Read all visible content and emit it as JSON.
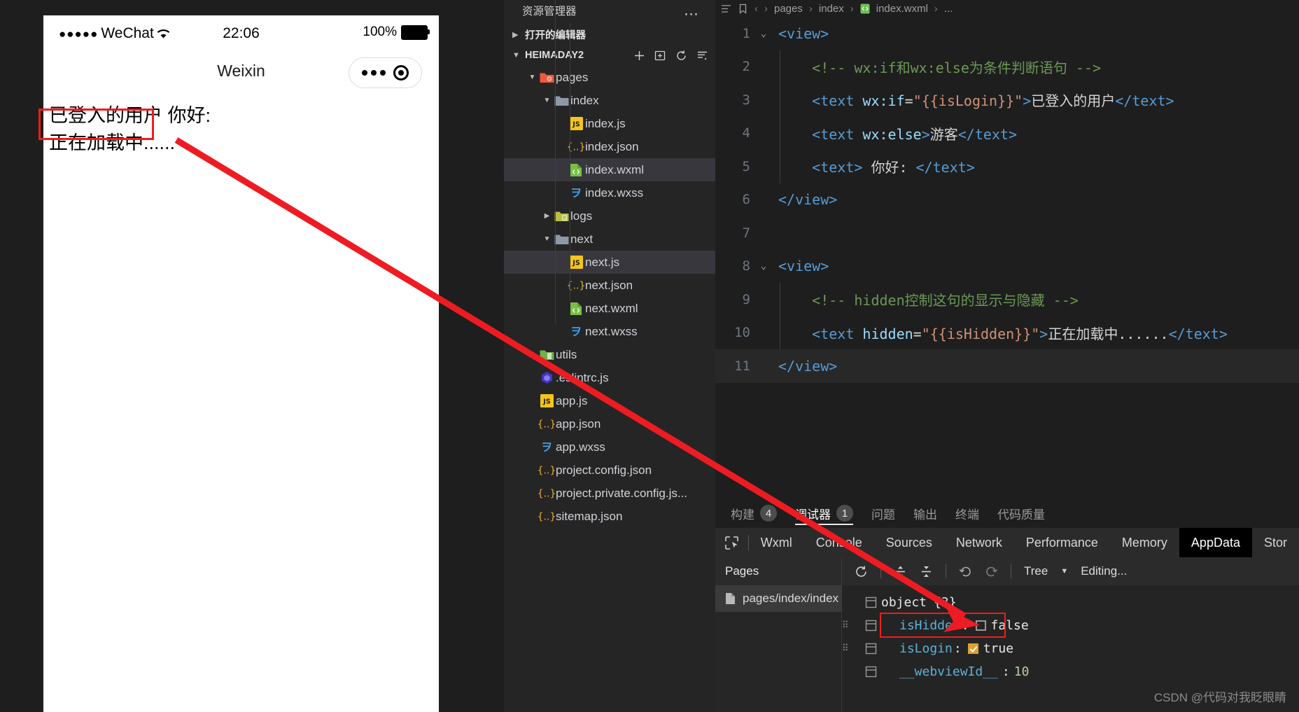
{
  "simulator": {
    "status_bar": {
      "carrier": "WeChat",
      "signal_dots": "●●●●●",
      "wifi_icon": "wifi-icon",
      "time": "22:06",
      "battery_percent": "100%"
    },
    "nav": {
      "title": "Weixin",
      "capsule_more_icon": "more-dots-icon",
      "capsule_target_icon": "target-icon"
    },
    "content": {
      "line1": "已登入的用户 你好:",
      "line2": "正在加载中......"
    }
  },
  "explorer": {
    "title": "资源管理器",
    "more_icon": "ellipsis-icon",
    "open_editors": {
      "label": "打开的编辑器",
      "twisty": "▶"
    },
    "project": {
      "label": "HEIMADAY2",
      "twisty": "▼",
      "actions": [
        "new-file-icon",
        "new-folder-icon",
        "refresh-icon",
        "collapse-all-icon"
      ]
    },
    "tree": [
      {
        "label": "pages",
        "icon": "folder-open-pages",
        "indent": 1,
        "twisty": "▼",
        "selected": false
      },
      {
        "label": "index",
        "icon": "folder-open",
        "indent": 2,
        "twisty": "▼",
        "selected": false
      },
      {
        "label": "index.js",
        "icon": "js-icon",
        "indent": 3,
        "twisty": "",
        "selected": false
      },
      {
        "label": "index.json",
        "icon": "json-icon",
        "indent": 3,
        "twisty": "",
        "selected": false
      },
      {
        "label": "index.wxml",
        "icon": "wxml-icon",
        "indent": 3,
        "twisty": "",
        "selected": true
      },
      {
        "label": "index.wxss",
        "icon": "wxss-icon",
        "indent": 3,
        "twisty": "",
        "selected": false
      },
      {
        "label": "logs",
        "icon": "folder-logs",
        "indent": 2,
        "twisty": "▶",
        "selected": false
      },
      {
        "label": "next",
        "icon": "folder-open",
        "indent": 2,
        "twisty": "▼",
        "selected": false
      },
      {
        "label": "next.js",
        "icon": "js-icon",
        "indent": 3,
        "twisty": "",
        "selected": true
      },
      {
        "label": "next.json",
        "icon": "json-icon",
        "indent": 3,
        "twisty": "",
        "selected": false
      },
      {
        "label": "next.wxml",
        "icon": "wxml-icon",
        "indent": 3,
        "twisty": "",
        "selected": false
      },
      {
        "label": "next.wxss",
        "icon": "wxss-icon",
        "indent": 3,
        "twisty": "",
        "selected": false
      },
      {
        "label": "utils",
        "icon": "folder-utils",
        "indent": 1,
        "twisty": "▶",
        "selected": false
      },
      {
        "label": ".eslintrc.js",
        "icon": "eslint-icon",
        "indent": 1,
        "twisty": "",
        "selected": false
      },
      {
        "label": "app.js",
        "icon": "js-icon",
        "indent": 1,
        "twisty": "",
        "selected": false
      },
      {
        "label": "app.json",
        "icon": "json-icon",
        "indent": 1,
        "twisty": "",
        "selected": false
      },
      {
        "label": "app.wxss",
        "icon": "wxss-icon",
        "indent": 1,
        "twisty": "",
        "selected": false
      },
      {
        "label": "project.config.json",
        "icon": "json-icon",
        "indent": 1,
        "twisty": "",
        "selected": false
      },
      {
        "label": "project.private.config.js...",
        "icon": "json-icon",
        "indent": 1,
        "twisty": "",
        "selected": false
      },
      {
        "label": "sitemap.json",
        "icon": "json-icon",
        "indent": 1,
        "twisty": "",
        "selected": false
      }
    ]
  },
  "editor": {
    "breadcrumb": [
      "pages",
      "index",
      "index.wxml",
      "..."
    ],
    "breadcrumb_file_icon": "wxml-icon",
    "nav_back_icon": "chevron-left-icon",
    "nav_forward_icon": "chevron-right-icon",
    "lines": [
      {
        "n": "1",
        "fold": "⌄",
        "indent": false,
        "active": false,
        "parts": [
          {
            "t": "<view>",
            "c": "tag"
          }
        ]
      },
      {
        "n": "2",
        "fold": "",
        "indent": true,
        "active": false,
        "parts": [
          {
            "t": "    <!-- wx:if和wx:else为条件判断语句 -->",
            "c": "cmt"
          }
        ]
      },
      {
        "n": "3",
        "fold": "",
        "indent": true,
        "active": false,
        "parts": [
          {
            "t": "    ",
            "c": "txt"
          },
          {
            "t": "<text ",
            "c": "tag"
          },
          {
            "t": "wx:if",
            "c": "attr"
          },
          {
            "t": "=",
            "c": "txt"
          },
          {
            "t": "\"{{isLogin}}\"",
            "c": "str"
          },
          {
            "t": ">",
            "c": "tag"
          },
          {
            "t": "已登入的用户",
            "c": "txt"
          },
          {
            "t": "</text>",
            "c": "tag"
          }
        ]
      },
      {
        "n": "4",
        "fold": "",
        "indent": true,
        "active": false,
        "parts": [
          {
            "t": "    ",
            "c": "txt"
          },
          {
            "t": "<text ",
            "c": "tag"
          },
          {
            "t": "wx:else",
            "c": "attr"
          },
          {
            "t": ">",
            "c": "tag"
          },
          {
            "t": "游客",
            "c": "txt"
          },
          {
            "t": "</text>",
            "c": "tag"
          }
        ]
      },
      {
        "n": "5",
        "fold": "",
        "indent": true,
        "active": false,
        "parts": [
          {
            "t": "    ",
            "c": "txt"
          },
          {
            "t": "<text>",
            "c": "tag"
          },
          {
            "t": " 你好: ",
            "c": "txt"
          },
          {
            "t": "</text>",
            "c": "tag"
          }
        ]
      },
      {
        "n": "6",
        "fold": "",
        "indent": false,
        "active": false,
        "parts": [
          {
            "t": "</view>",
            "c": "tag"
          }
        ]
      },
      {
        "n": "7",
        "fold": "",
        "indent": false,
        "active": false,
        "parts": []
      },
      {
        "n": "8",
        "fold": "⌄",
        "indent": false,
        "active": false,
        "parts": [
          {
            "t": "<view>",
            "c": "tag"
          }
        ]
      },
      {
        "n": "9",
        "fold": "",
        "indent": true,
        "active": false,
        "parts": [
          {
            "t": "    <!-- hidden控制这句的显示与隐藏 -->",
            "c": "cmt"
          }
        ]
      },
      {
        "n": "10",
        "fold": "",
        "indent": true,
        "active": false,
        "parts": [
          {
            "t": "    ",
            "c": "txt"
          },
          {
            "t": "<text ",
            "c": "tag"
          },
          {
            "t": "hidden",
            "c": "attr"
          },
          {
            "t": "=",
            "c": "txt"
          },
          {
            "t": "\"{{isHidden}}\"",
            "c": "str"
          },
          {
            "t": ">",
            "c": "tag"
          },
          {
            "t": "正在加载中......",
            "c": "txt"
          },
          {
            "t": "</text>",
            "c": "tag"
          }
        ]
      },
      {
        "n": "11",
        "fold": "",
        "indent": false,
        "active": true,
        "parts": [
          {
            "t": "</view>",
            "c": "tag"
          }
        ]
      }
    ]
  },
  "panel": {
    "tabs": [
      {
        "label": "构建",
        "badge": "4",
        "active": false
      },
      {
        "label": "调试器",
        "badge": "1",
        "active": true
      },
      {
        "label": "问题",
        "badge": "",
        "active": false
      },
      {
        "label": "输出",
        "badge": "",
        "active": false
      },
      {
        "label": "终端",
        "badge": "",
        "active": false
      },
      {
        "label": "代码质量",
        "badge": "",
        "active": false
      }
    ]
  },
  "devtools": {
    "inspect_icon": "inspect-element-icon",
    "tabs": [
      {
        "label": "Wxml",
        "active": false
      },
      {
        "label": "Console",
        "active": false
      },
      {
        "label": "Sources",
        "active": false
      },
      {
        "label": "Network",
        "active": false
      },
      {
        "label": "Performance",
        "active": false
      },
      {
        "label": "Memory",
        "active": false
      },
      {
        "label": "AppData",
        "active": true
      },
      {
        "label": "Stor",
        "active": false
      }
    ],
    "pages_pane": {
      "header": "Pages",
      "items": [
        {
          "label": "pages/index/index",
          "icon": "file-icon",
          "selected": true
        }
      ]
    },
    "data_toolbar": {
      "refresh_icon": "refresh-icon",
      "expand_icon": "expand-all-icon",
      "collapse_icon": "collapse-all-icon",
      "undo_icon": "undo-icon",
      "redo_icon": "redo-icon",
      "mode_label": "Tree",
      "mode_caret": "▼",
      "status_label": "Editing..."
    },
    "data_tree": [
      {
        "key": "object",
        "value": "{3}",
        "type": "object",
        "indent": 0,
        "grip": false,
        "highlighted": false
      },
      {
        "key": "isHidden",
        "value": "false",
        "type": "bool",
        "checked": false,
        "indent": 1,
        "grip": true,
        "highlighted": true
      },
      {
        "key": "isLogin",
        "value": "true",
        "type": "bool",
        "checked": true,
        "indent": 1,
        "grip": true,
        "highlighted": false
      },
      {
        "key": "__webviewId__",
        "value": "10",
        "type": "number",
        "indent": 1,
        "grip": false,
        "highlighted": false
      }
    ]
  },
  "annotation": {
    "arrow_color": "#ee1c22",
    "highlight_color": "#f01c1c"
  },
  "watermark": "CSDN @代码对我眨眼睛"
}
